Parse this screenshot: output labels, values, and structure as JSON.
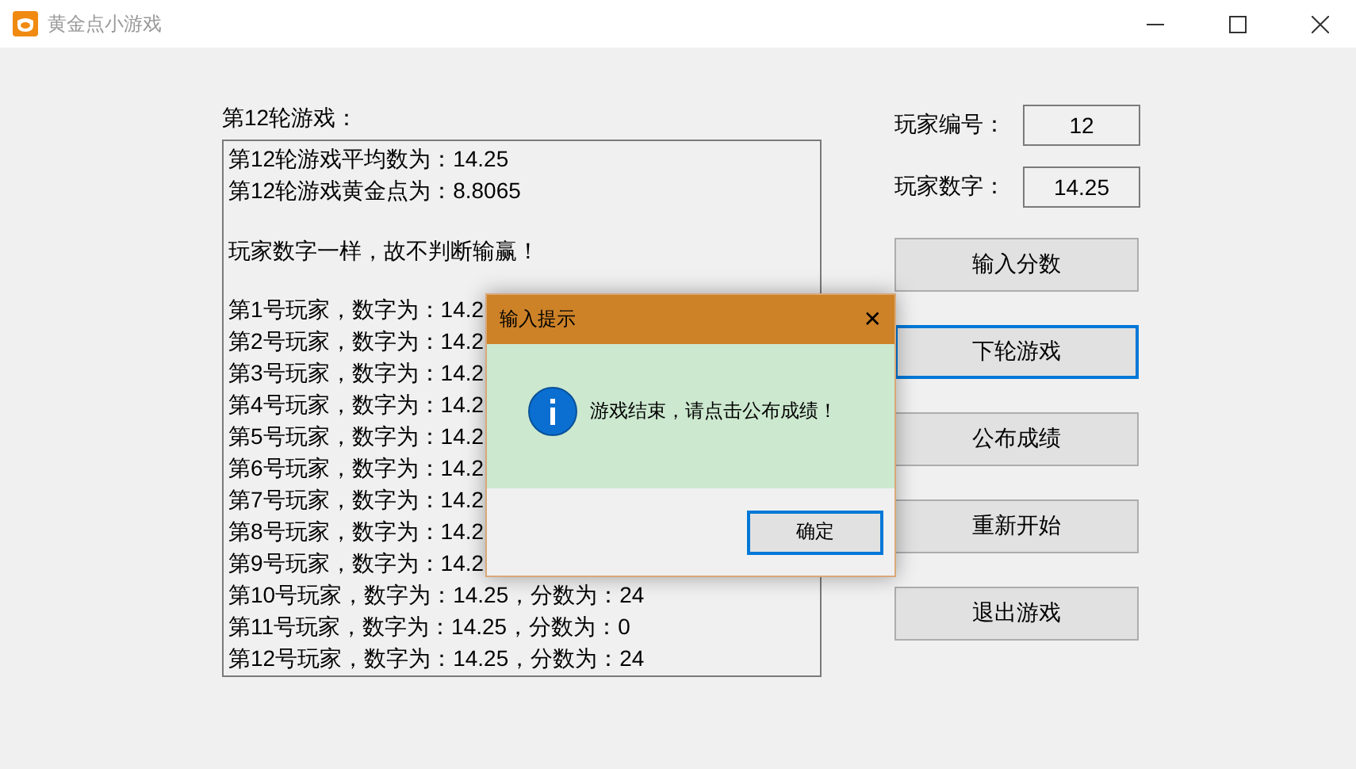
{
  "window": {
    "title": "黄金点小游戏"
  },
  "log": {
    "label": "第12轮游戏：",
    "sections": [
      [
        "第12轮游戏平均数为：14.25",
        "第12轮游戏黄金点为：8.8065"
      ],
      [
        "玩家数字一样，故不判断输赢！"
      ],
      [
        "第1号玩家，数字为：14.2",
        "第2号玩家，数字为：14.2",
        "第3号玩家，数字为：14.2",
        "第4号玩家，数字为：14.2",
        "第5号玩家，数字为：14.2",
        "第6号玩家，数字为：14.2",
        "第7号玩家，数字为：14.2",
        "第8号玩家，数字为：14.2",
        "第9号玩家，数字为：14.2",
        "第10号玩家，数字为：14.25，分数为：24",
        "第11号玩家，数字为：14.25，分数为：0",
        "第12号玩家，数字为：14.25，分数为：24"
      ]
    ]
  },
  "fields": [
    {
      "label": "玩家编号：",
      "value": "12"
    },
    {
      "label": "玩家数字：",
      "value": "14.25"
    }
  ],
  "buttons": [
    {
      "label": "输入分数",
      "focused": false
    },
    {
      "label": "下轮游戏",
      "focused": true
    },
    {
      "label": "公布成绩",
      "focused": false
    },
    {
      "label": "重新开始",
      "focused": false
    },
    {
      "label": "退出游戏",
      "focused": false
    }
  ],
  "dialog": {
    "title": "输入提示",
    "close": "✕",
    "message": "游戏结束，请点击公布成绩！",
    "ok": {
      "label": "确定",
      "focused": true
    }
  }
}
